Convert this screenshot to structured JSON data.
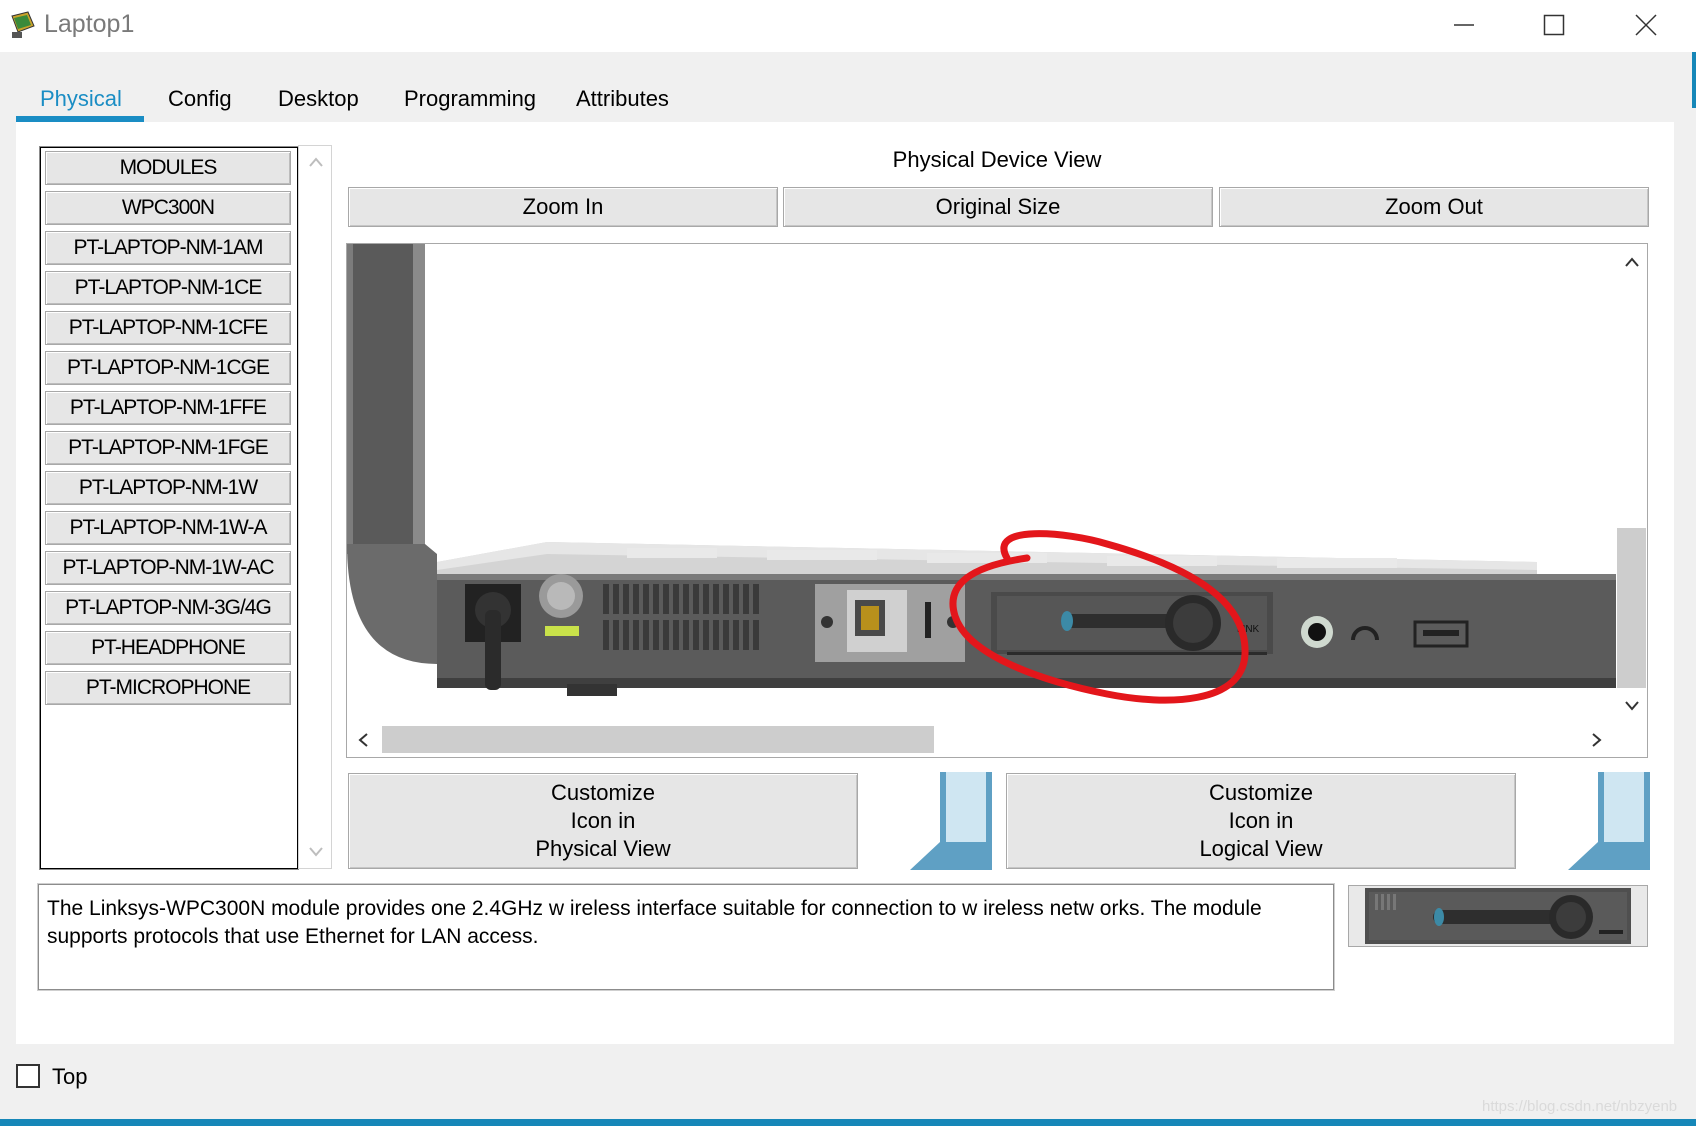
{
  "window": {
    "title": "Laptop1"
  },
  "tabs": [
    {
      "label": "Physical",
      "active": true
    },
    {
      "label": "Config"
    },
    {
      "label": "Desktop"
    },
    {
      "label": "Programming"
    },
    {
      "label": "Attributes"
    }
  ],
  "modules": [
    "MODULES",
    "WPC300N",
    "PT-LAPTOP-NM-1AM",
    "PT-LAPTOP-NM-1CE",
    "PT-LAPTOP-NM-1CFE",
    "PT-LAPTOP-NM-1CGE",
    "PT-LAPTOP-NM-1FFE",
    "PT-LAPTOP-NM-1FGE",
    "PT-LAPTOP-NM-1W",
    "PT-LAPTOP-NM-1W-A",
    "PT-LAPTOP-NM-1W-AC",
    "PT-LAPTOP-NM-3G/4G",
    "PT-HEADPHONE",
    "PT-MICROPHONE"
  ],
  "physical_view": {
    "title": "Physical Device View",
    "zoom_in": "Zoom In",
    "original_size": "Original Size",
    "zoom_out": "Zoom Out",
    "module_label": "LINK"
  },
  "customize": {
    "physical": [
      "Customize",
      "Icon in",
      "Physical View"
    ],
    "logical": [
      "Customize",
      "Icon in",
      "Logical View"
    ]
  },
  "description": "The Linksys-WPC300N module provides one 2.4GHz w ireless interface suitable for connection to w ireless netw orks. The module supports protocols that use Ethernet for LAN access.",
  "footer": {
    "top_label": "Top",
    "top_checked": false,
    "watermark": "https://blog.csdn.net/nbzyenb"
  },
  "colors": {
    "accent": "#1a8dc4",
    "annotation": "#e3161b"
  }
}
